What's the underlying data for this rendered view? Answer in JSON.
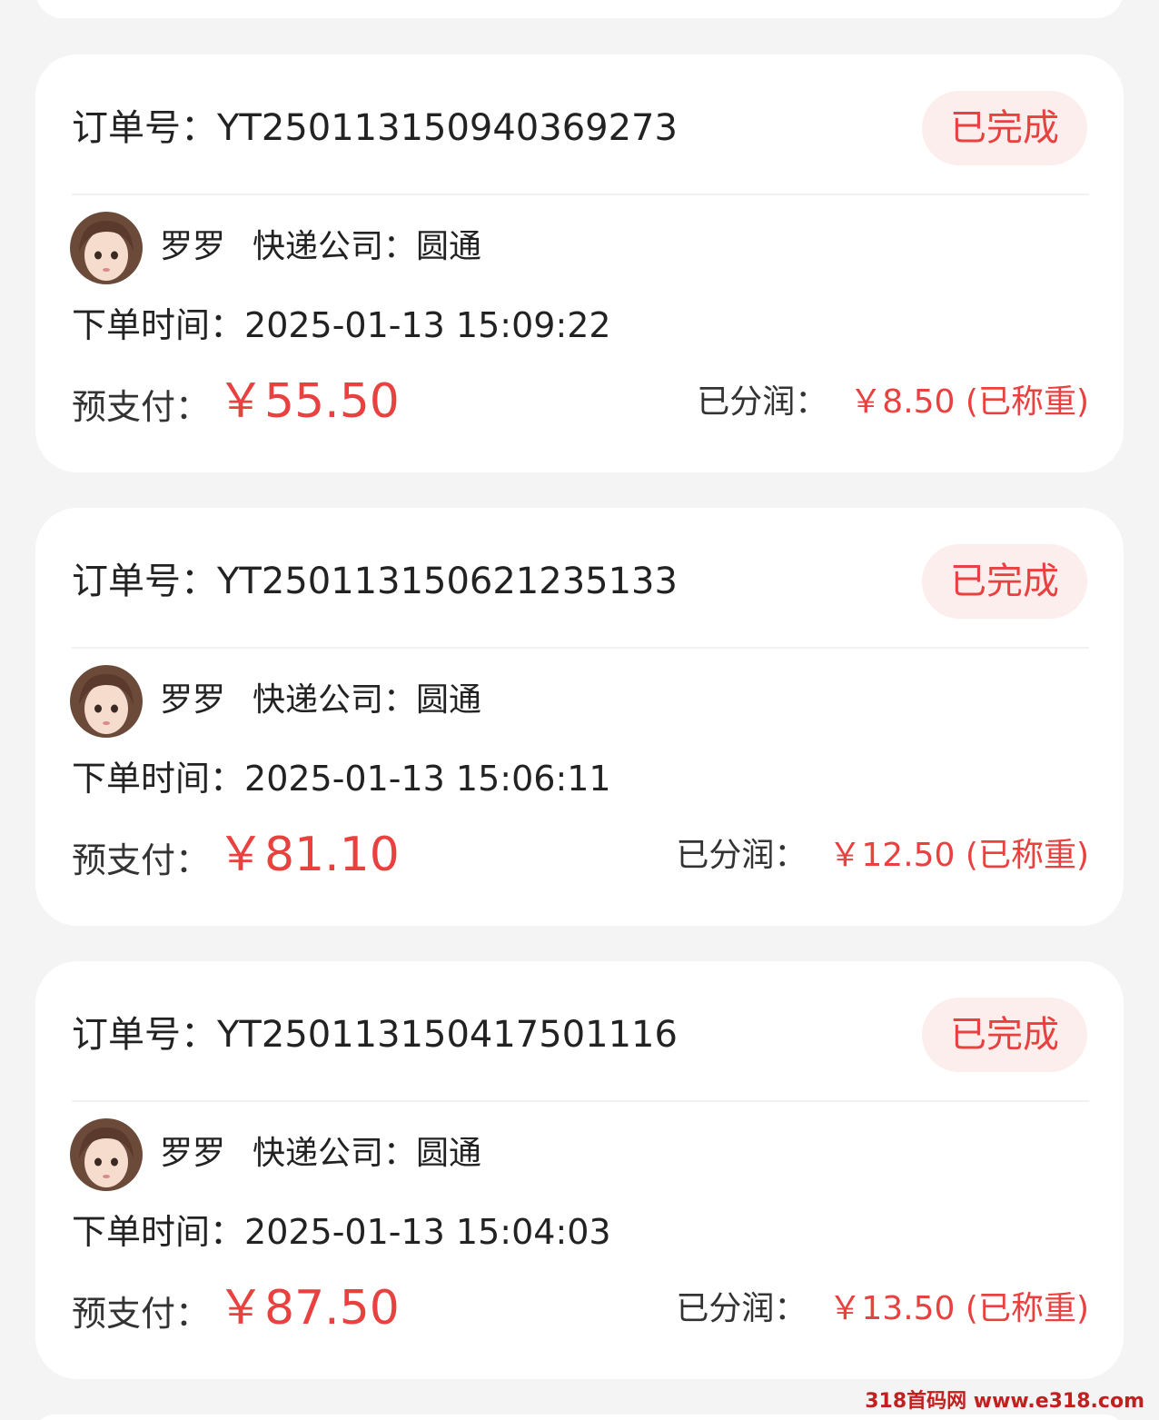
{
  "labels": {
    "order_no": "订单号：",
    "courier": "快递公司：",
    "order_time": "下单时间：",
    "prepay": "预支付：",
    "profit": "已分润："
  },
  "orders": [
    {
      "order_no": "YT2501131509403692​73",
      "status": "已完成",
      "user_name": "罗罗",
      "courier": "圆通",
      "order_time": "2025-01-13 15:09:22",
      "prepay": "￥55.50",
      "profit": "￥8.50 (已称重)"
    },
    {
      "order_no": "YT250113150621235133",
      "status": "已完成",
      "user_name": "罗罗",
      "courier": "圆通",
      "order_time": "2025-01-13 15:06:11",
      "prepay": "￥81.10",
      "profit": "￥12.50 (已称重)"
    },
    {
      "order_no": "YT250113150417501116",
      "status": "已完成",
      "user_name": "罗罗",
      "courier": "圆通",
      "order_time": "2025-01-13 15:04:03",
      "prepay": "￥87.50",
      "profit": "￥13.50 (已称重)"
    }
  ],
  "watermark": "318首码网 www.e318.com",
  "colors": {
    "accent": "#e8413f",
    "badge_bg": "#fdeeee",
    "page_bg": "#f4f4f4",
    "card_bg": "#ffffff"
  }
}
